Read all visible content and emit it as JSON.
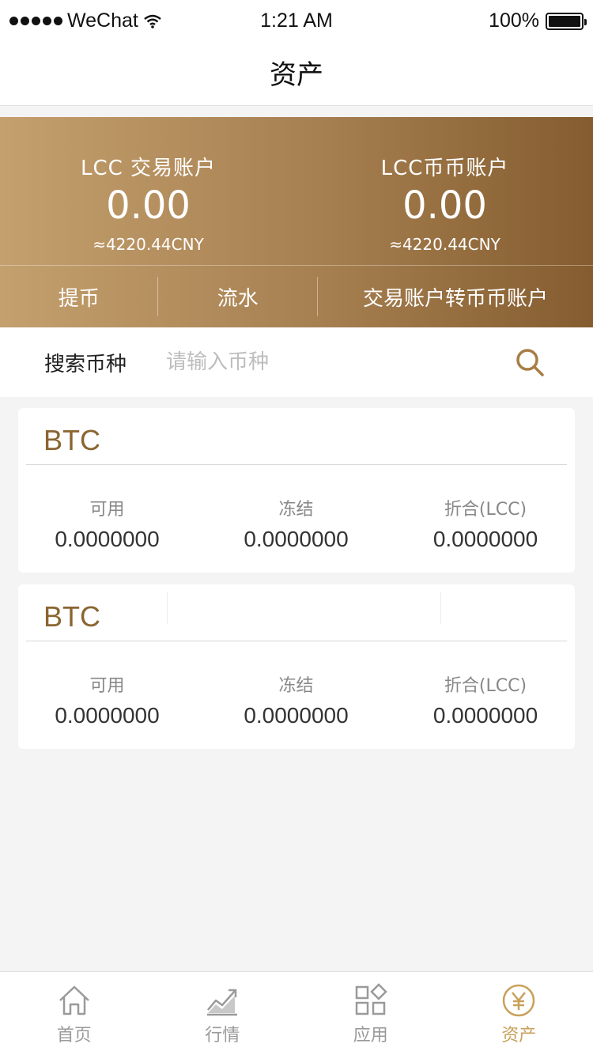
{
  "status_bar": {
    "carrier": "WeChat",
    "time": "1:21 AM",
    "battery": "100%"
  },
  "nav": {
    "title": "资产"
  },
  "banner": {
    "accounts": [
      {
        "name": "LCC 交易账户",
        "value": "0.00",
        "approx": "≈4220.44CNY"
      },
      {
        "name": "LCC币币账户",
        "value": "0.00",
        "approx": "≈4220.44CNY"
      }
    ],
    "actions": [
      "提币",
      "流水",
      "交易账户转币币账户"
    ]
  },
  "search": {
    "label": "搜索币种",
    "placeholder": "请输入币种"
  },
  "cards": [
    {
      "title": "BTC",
      "columns": [
        {
          "label": "可用",
          "value": "0.0000000"
        },
        {
          "label": "冻结",
          "value": "0.0000000"
        },
        {
          "label": "折合(LCC)",
          "value": "0.0000000"
        }
      ]
    },
    {
      "title": "BTC",
      "columns": [
        {
          "label": "可用",
          "value": "0.0000000"
        },
        {
          "label": "冻结",
          "value": "0.0000000"
        },
        {
          "label": "折合(LCC)",
          "value": "0.0000000"
        }
      ]
    }
  ],
  "tab_bar": {
    "tabs": [
      {
        "label": "首页",
        "icon": "home-icon"
      },
      {
        "label": "行情",
        "icon": "chart-icon"
      },
      {
        "label": "应用",
        "icon": "apps-icon"
      },
      {
        "label": "资产",
        "icon": "yen-icon",
        "active": true
      }
    ]
  },
  "colors": {
    "gold_start": "#c4a06e",
    "gold_end": "#845c2f",
    "accent": "#c9a15a",
    "card_title": "#8a6530"
  }
}
